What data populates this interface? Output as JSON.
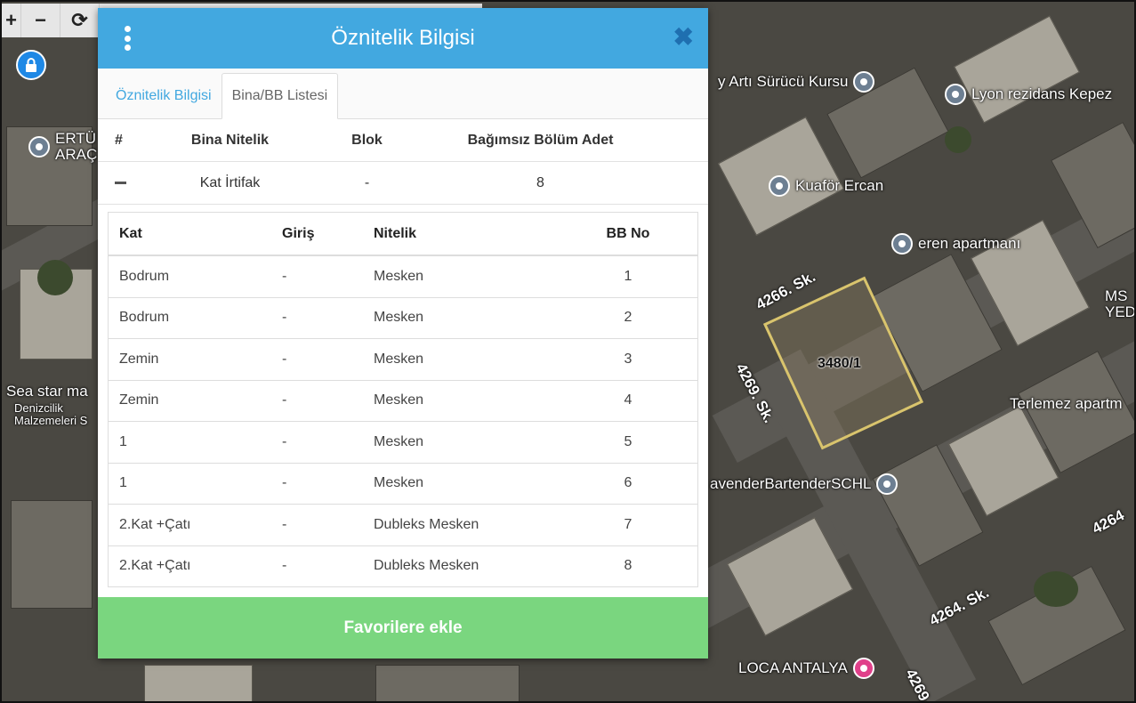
{
  "map": {
    "parcel_label": "3480/1",
    "pois": [
      {
        "name": "poi-surucu-kursu",
        "label": "y Artı Sürücü Kursu"
      },
      {
        "name": "poi-lyon-rezidans",
        "label": "Lyon rezidans Kepez"
      },
      {
        "name": "poi-kuafor-ercan",
        "label": "Kuaför Ercan"
      },
      {
        "name": "poi-eren-apartmani",
        "label": "eren apartmanı"
      },
      {
        "name": "poi-terlemez",
        "label": "Terlemez apartm"
      },
      {
        "name": "poi-bartender",
        "label": "avenderBartenderSCHL"
      },
      {
        "name": "poi-loca-antalya",
        "label": "LOCA ANTALYA"
      },
      {
        "name": "poi-ertu",
        "label": "ERTÜ ARAÇ"
      },
      {
        "name": "poi-sea-star",
        "label": "Sea star ma"
      },
      {
        "name": "poi-denizcilik",
        "label": "Denizcilik Malzemeleri S"
      },
      {
        "name": "poi-ms-yedi",
        "label": "MS YEDİ"
      }
    ],
    "streets": [
      "4266. Sk.",
      "4269. Sk.",
      "4264. Sk.",
      "4264",
      "4269"
    ],
    "toolbar": [
      "+",
      "−",
      "⟳"
    ]
  },
  "dialog": {
    "title": "Öznitelik Bilgisi",
    "close": "✖",
    "tabs": [
      {
        "label": "Öznitelik Bilgisi",
        "active": false
      },
      {
        "label": "Bina/BB Listesi",
        "active": true
      }
    ],
    "summary": {
      "headers": [
        "#",
        "Bina Nitelik",
        "Blok",
        "Bağımsız Bölüm Adet"
      ],
      "row": {
        "nitelik": "Kat İrtifak",
        "blok": "-",
        "adet": "8"
      }
    },
    "detail": {
      "headers": [
        "Kat",
        "Giriş",
        "Nitelik",
        "BB No"
      ],
      "rows": [
        [
          "Bodrum",
          "-",
          "Mesken",
          "1"
        ],
        [
          "Bodrum",
          "-",
          "Mesken",
          "2"
        ],
        [
          "Zemin",
          "-",
          "Mesken",
          "3"
        ],
        [
          "Zemin",
          "-",
          "Mesken",
          "4"
        ],
        [
          "1",
          "-",
          "Mesken",
          "5"
        ],
        [
          "1",
          "-",
          "Mesken",
          "6"
        ],
        [
          "2.Kat +Çatı",
          "-",
          "Dubleks Mesken",
          "7"
        ],
        [
          "2.Kat +Çatı",
          "-",
          "Dubleks Mesken",
          "8"
        ]
      ]
    },
    "favorite_button": "Favorilere ekle"
  },
  "colors": {
    "header": "#42a8e0",
    "favorite": "#7ad67f",
    "parcel": "#d9c46d"
  }
}
